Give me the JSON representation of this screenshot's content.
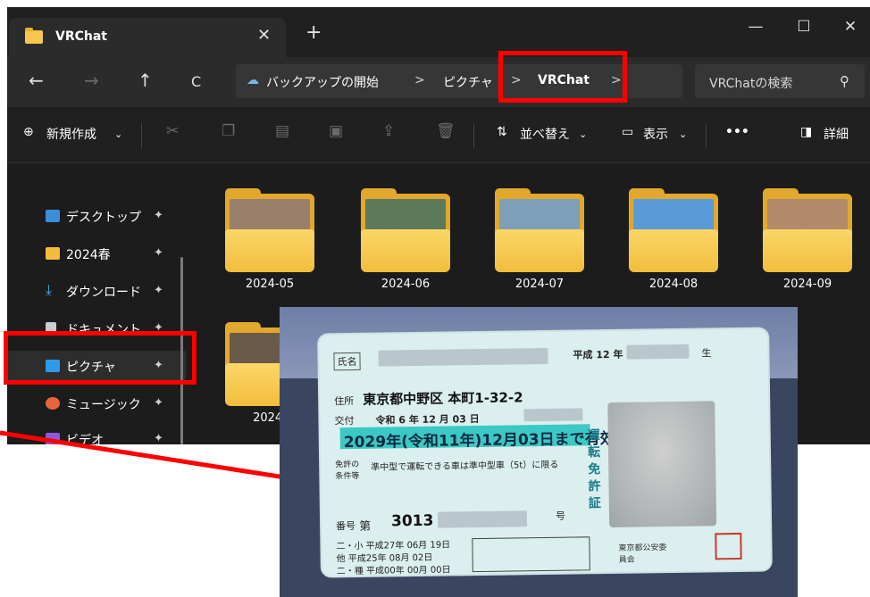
{
  "window": {
    "tab_title": "VRChat",
    "tab_close": "✕",
    "new_tab": "+",
    "minimize": "—",
    "maximize": "☐",
    "close": "✕"
  },
  "address": {
    "back": "←",
    "forward": "→",
    "up": "↑",
    "refresh": "C",
    "crumbs": [
      "バックアップの開始",
      "ピクチャ",
      "VRChat"
    ],
    "separator": ">",
    "search_placeholder": "VRChatの検索",
    "search_icon": "🔍"
  },
  "toolbar": {
    "new": "新規作成",
    "sort": "並べ替え",
    "view": "表示",
    "more": "•••",
    "details": "詳細"
  },
  "sidebar": {
    "items": [
      {
        "label": "デスクトップ",
        "icon": "desktop-icon",
        "color": "#3a8fd8"
      },
      {
        "label": "2024春",
        "icon": "folder-icon",
        "color": "#f2bd3c"
      },
      {
        "label": "ダウンロード",
        "icon": "download-icon",
        "color": "#3fb1e8"
      },
      {
        "label": "ドキュメント",
        "icon": "document-icon",
        "color": "#c8ccd4"
      },
      {
        "label": "ピクチャ",
        "icon": "pictures-icon",
        "color": "#2e9bea"
      },
      {
        "label": "ミュージック",
        "icon": "music-icon",
        "color": "#e8643c"
      },
      {
        "label": "ビデオ",
        "icon": "video-icon",
        "color": "#8a5ae0"
      }
    ],
    "pin": "📌"
  },
  "folders": [
    {
      "name": "2024-05",
      "photo": "#9a7f6a"
    },
    {
      "name": "2024-06",
      "photo": "#5c7a5a"
    },
    {
      "name": "2024-07",
      "photo": "#7f9fb8"
    },
    {
      "name": "2024-08",
      "photo": "#5a9ad8"
    },
    {
      "name": "2024-09",
      "photo": "#b08a6a"
    },
    {
      "name": "2024-",
      "photo": "#6a5a4a"
    }
  ],
  "license": {
    "name_label": "氏名",
    "birth": "平成 12 年",
    "birth_suffix": "生",
    "address_label": "住所",
    "address": "東京都中野区 本町1-32-2",
    "issue_label": "交付",
    "issue_date": "令和 6 年 12 月 03 日",
    "expiry": "2029年(令和11年)12月03日まで有効",
    "condition_label": "免許の条件等",
    "condition": "準中型で運転できる車は準中型車（5t）に限る",
    "number_label": "番号",
    "number_prefix": "第",
    "number": "3013",
    "number_suffix": "号",
    "vertical": "運転免許証",
    "history_1": "二・小 平成27年 06月 19日",
    "history_2": "他 平成25年 08月 02日",
    "history_3": "二・種 平成00年 00月 00日",
    "issuer": "東京都公安委員会",
    "seal": "東京都公安"
  }
}
